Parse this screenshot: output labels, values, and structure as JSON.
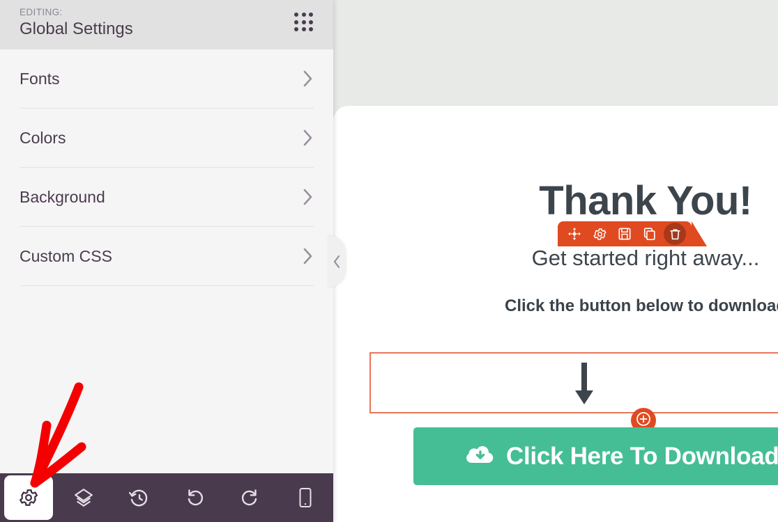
{
  "sidebar": {
    "header": {
      "editing_label": "EDITING:",
      "title": "Global Settings",
      "drag_handle_icon": "grid-dots-icon"
    },
    "menu_items": [
      {
        "label": "Fonts",
        "chevron_icon": "chevron-right-icon"
      },
      {
        "label": "Colors",
        "chevron_icon": "chevron-right-icon"
      },
      {
        "label": "Background",
        "chevron_icon": "chevron-right-icon"
      },
      {
        "label": "Custom CSS",
        "chevron_icon": "chevron-right-icon"
      }
    ],
    "collapse_tab": {
      "icon": "chevron-left-icon"
    }
  },
  "bottom_toolbar": {
    "buttons": [
      {
        "name": "settings",
        "icon": "gear-icon",
        "active": true
      },
      {
        "name": "layers",
        "icon": "layers-icon",
        "active": false
      },
      {
        "name": "revisions",
        "icon": "history-clock-icon",
        "active": false
      },
      {
        "name": "undo",
        "icon": "undo-icon",
        "active": false
      },
      {
        "name": "redo",
        "icon": "redo-icon",
        "active": false
      },
      {
        "name": "responsive",
        "icon": "mobile-device-icon",
        "active": false
      }
    ]
  },
  "preview": {
    "title": "Thank You!",
    "subtitle": "Get started right away...",
    "instruction": "Click the button below to download",
    "cta": {
      "label": "Click Here To Download",
      "icon": "cloud-download-icon"
    },
    "module_toolbar": {
      "buttons": [
        {
          "name": "move",
          "icon": "move-arrows-icon",
          "active": false
        },
        {
          "name": "settings",
          "icon": "gear-icon",
          "active": false
        },
        {
          "name": "save",
          "icon": "floppy-save-icon",
          "active": false
        },
        {
          "name": "duplicate",
          "icon": "copy-icon",
          "active": false
        },
        {
          "name": "delete",
          "icon": "trash-icon",
          "active": true
        }
      ]
    },
    "add_module_button": {
      "icon": "plus-circle-icon"
    },
    "module_graphic_icon": "down-arrow-icon"
  },
  "colors": {
    "accent_orange": "#e04a21",
    "cta_green": "#45be95",
    "toolbar_purple": "#4a3a4e",
    "sidebar_bg": "#f5f5f5",
    "sidebar_header_bg": "#e1e1e1",
    "preview_bg": "#e7eae7",
    "annotation_red": "#f40000",
    "text_dark": "#4a3b4e",
    "module_border": "#e8745a"
  }
}
